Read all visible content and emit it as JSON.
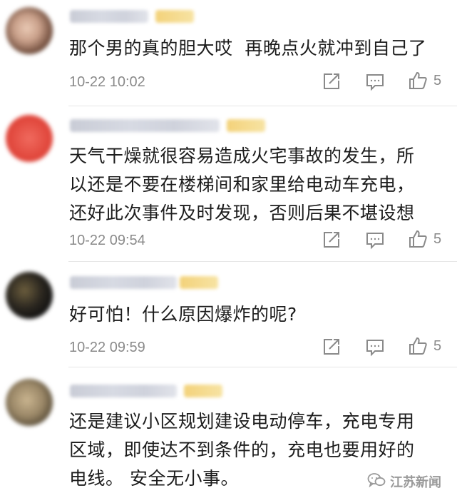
{
  "comments": [
    {
      "text": "那个男的真的胆大哎  再晚点火就冲到自己了",
      "time": "10-22 10:02",
      "likes": "5",
      "avatar_color": "#b89a86"
    },
    {
      "text": "天气干燥就很容易造成火宅事故的发生，所\n以还是不要在楼梯间和家里给电动车充电，\n还好此次事件及时发现，否则后果不堪设想",
      "time": "10-22 09:54",
      "likes": "5",
      "avatar_color": "#e24a3f"
    },
    {
      "text": "好可怕！什么原因爆炸的呢?",
      "time": "10-22 09:59",
      "likes": "5",
      "avatar_color": "#2a261f"
    },
    {
      "text": "还是建议小区规划建设电动停车，充电专用\n区域，即使达不到条件的，充电也要用好的\n电线。 安全无小事。",
      "avatar_color": "#9a8767"
    }
  ],
  "icons": {
    "share": "share-icon",
    "comment": "comment-icon",
    "like": "thumbs-up-icon",
    "watermark": "wechat-icon"
  },
  "watermark": {
    "text": "江苏新闻"
  }
}
